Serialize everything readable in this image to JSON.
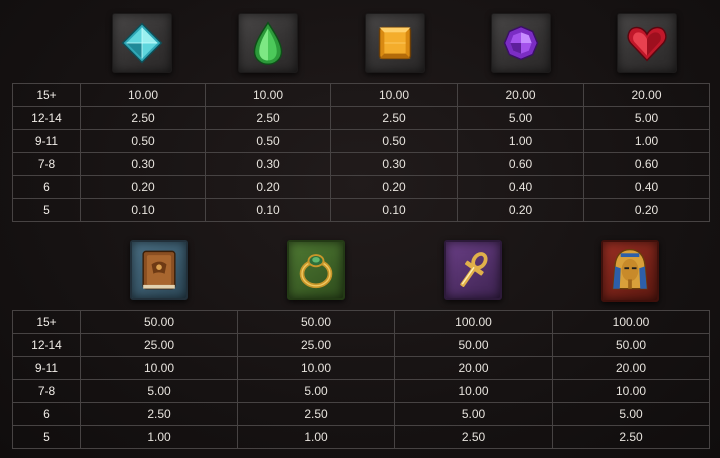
{
  "top_table": {
    "symbols": [
      {
        "icon": "blue-diamond-gem-icon"
      },
      {
        "icon": "green-teardrop-gem-icon"
      },
      {
        "icon": "orange-square-gem-icon"
      },
      {
        "icon": "purple-round-gem-icon"
      },
      {
        "icon": "red-heart-gem-icon"
      }
    ],
    "rows": [
      {
        "label": "15+",
        "values": [
          "10.00",
          "10.00",
          "10.00",
          "20.00",
          "20.00"
        ]
      },
      {
        "label": "12-14",
        "values": [
          "2.50",
          "2.50",
          "2.50",
          "5.00",
          "5.00"
        ]
      },
      {
        "label": "9-11",
        "values": [
          "0.50",
          "0.50",
          "0.50",
          "1.00",
          "1.00"
        ]
      },
      {
        "label": "7-8",
        "values": [
          "0.30",
          "0.30",
          "0.30",
          "0.60",
          "0.60"
        ]
      },
      {
        "label": "6",
        "values": [
          "0.20",
          "0.20",
          "0.20",
          "0.40",
          "0.40"
        ]
      },
      {
        "label": "5",
        "values": [
          "0.10",
          "0.10",
          "0.10",
          "0.20",
          "0.20"
        ]
      }
    ]
  },
  "bottom_table": {
    "symbols": [
      {
        "icon": "book-of-dead-icon",
        "tile_color": "#3e5b6c"
      },
      {
        "icon": "scarab-ring-icon",
        "tile_color": "#3f6428"
      },
      {
        "icon": "golden-ankh-icon",
        "tile_color": "#55326b"
      },
      {
        "icon": "pharaoh-mask-icon",
        "tile_color": "#7a2218"
      }
    ],
    "rows": [
      {
        "label": "15+",
        "values": [
          "50.00",
          "50.00",
          "100.00",
          "100.00"
        ]
      },
      {
        "label": "12-14",
        "values": [
          "25.00",
          "25.00",
          "50.00",
          "50.00"
        ]
      },
      {
        "label": "9-11",
        "values": [
          "10.00",
          "10.00",
          "20.00",
          "20.00"
        ]
      },
      {
        "label": "7-8",
        "values": [
          "5.00",
          "5.00",
          "10.00",
          "10.00"
        ]
      },
      {
        "label": "6",
        "values": [
          "2.50",
          "2.50",
          "5.00",
          "5.00"
        ]
      },
      {
        "label": "5",
        "values": [
          "1.00",
          "1.00",
          "2.50",
          "2.50"
        ]
      }
    ]
  }
}
